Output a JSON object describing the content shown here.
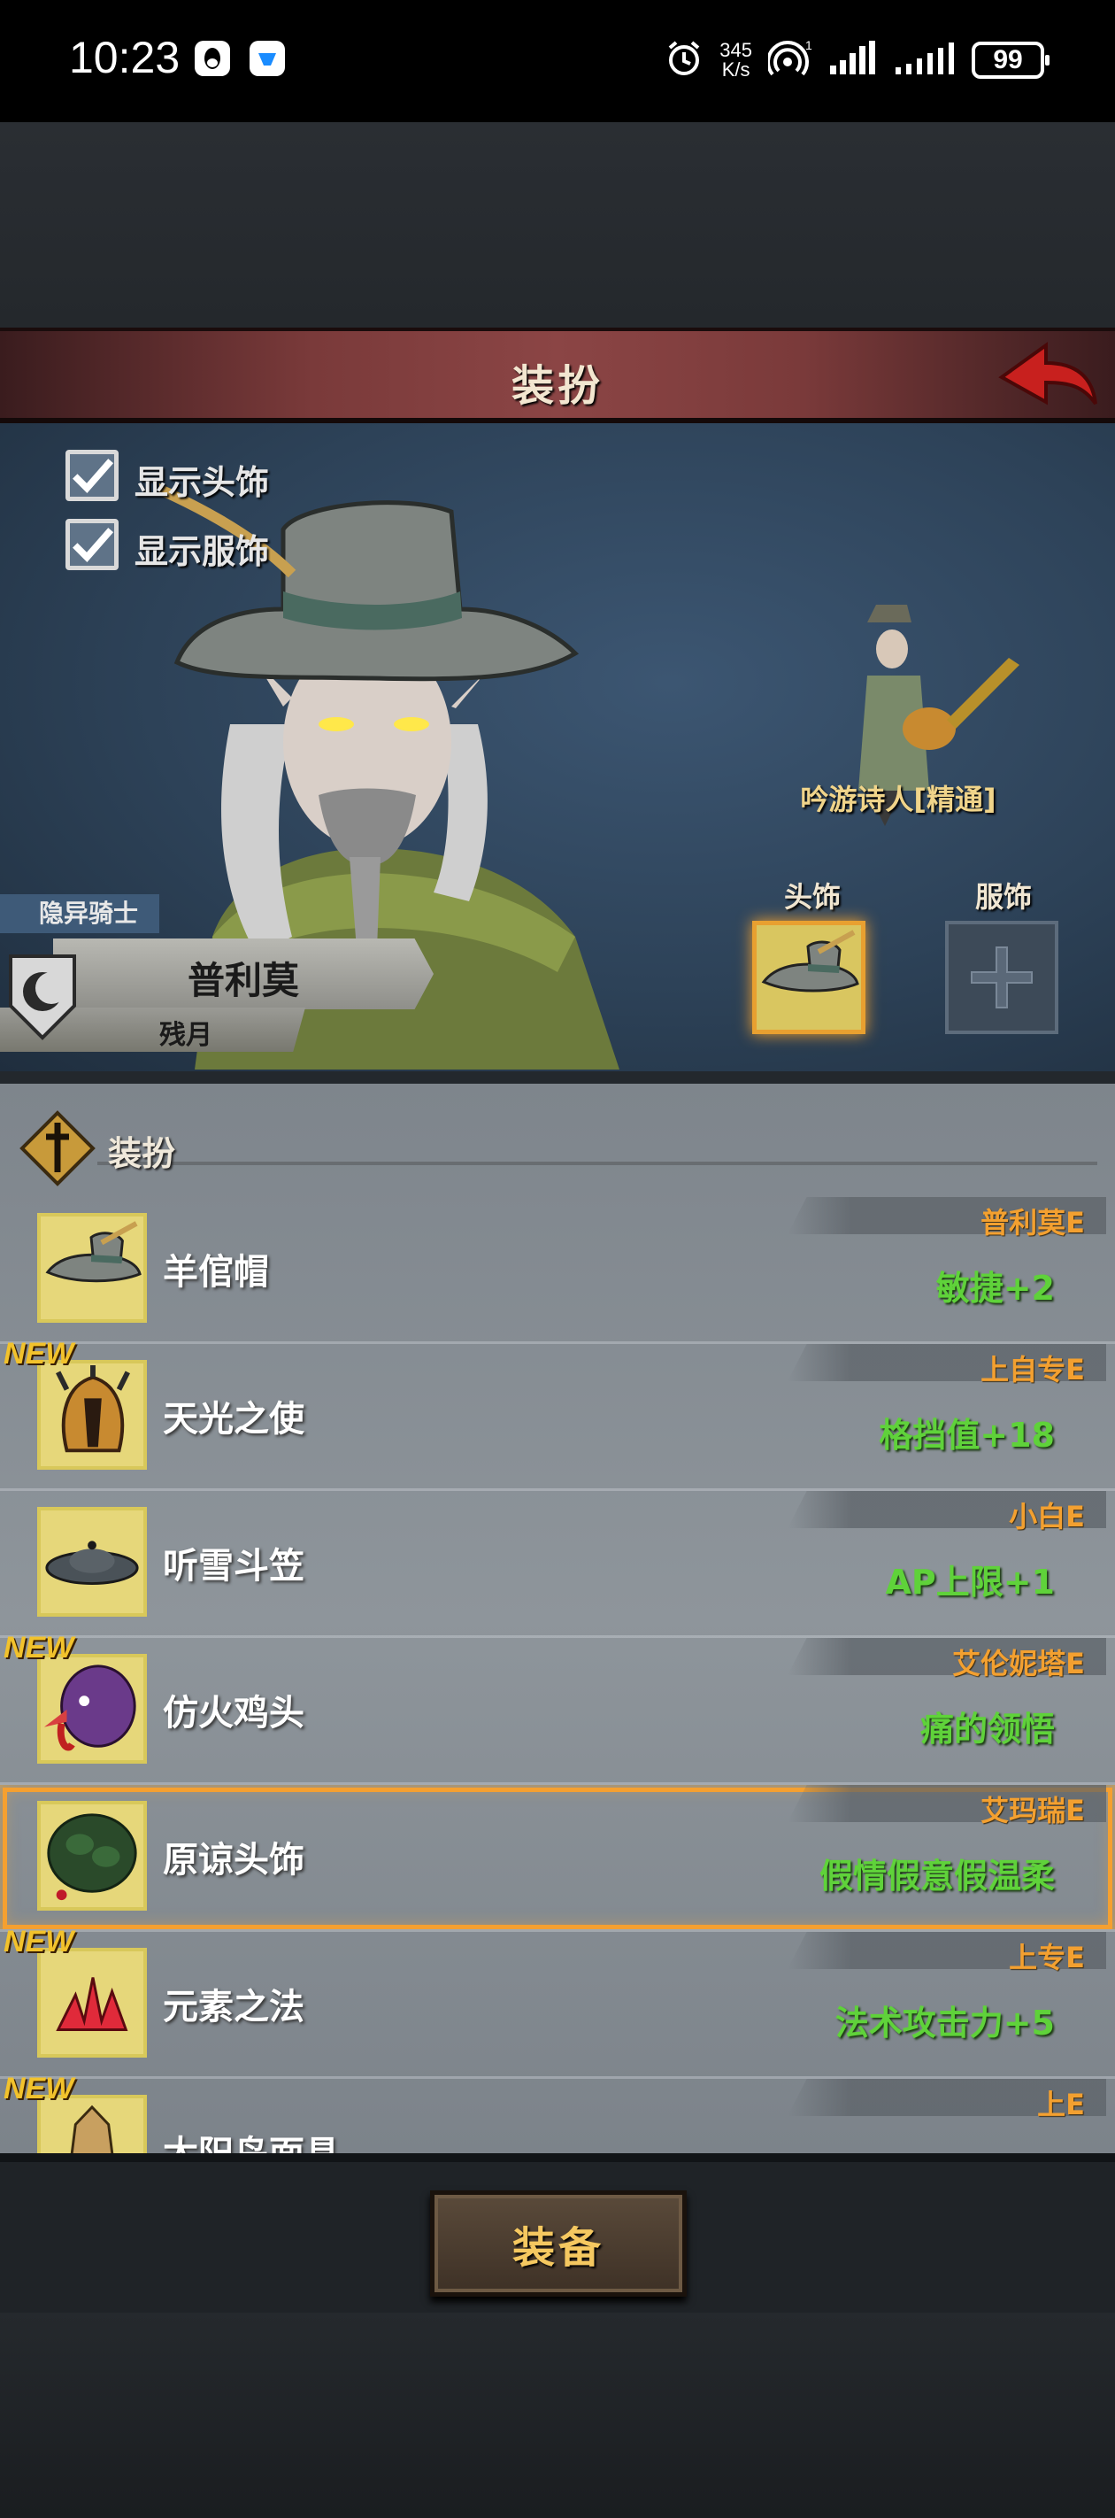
{
  "status_bar": {
    "time": "10:23",
    "net_speed_value": "345",
    "net_speed_unit": "K/s",
    "battery": "99"
  },
  "header": {
    "title": "装扮"
  },
  "options": {
    "show_headwear_label": "显示头饰",
    "show_outfit_label": "显示服饰",
    "show_headwear_checked": true,
    "show_outfit_checked": true
  },
  "character": {
    "title": "隐异骑士",
    "name": "普利莫",
    "subtitle": "残月",
    "class_name": "吟游诗人[精通]"
  },
  "slots": {
    "head_label": "头饰",
    "body_label": "服饰"
  },
  "list": {
    "section_label": "装扮",
    "items": [
      {
        "name": "羊倌帽",
        "owner": "普利莫E",
        "stat": "敏捷+2",
        "is_new": false,
        "new_label": "",
        "selected": false
      },
      {
        "name": "天光之使",
        "owner": "上自专E",
        "stat": "格挡值+18",
        "is_new": true,
        "new_label": "NEW",
        "selected": false
      },
      {
        "name": "听雪斗笠",
        "owner": "小白E",
        "stat": "AP上限+1",
        "is_new": false,
        "new_label": "",
        "selected": false
      },
      {
        "name": "仿火鸡头",
        "owner": "艾伦妮塔E",
        "stat": "痛的领悟",
        "is_new": true,
        "new_label": "NEW",
        "selected": false
      },
      {
        "name": "原谅头饰",
        "owner": "艾玛瑞E",
        "stat": "假情假意假温柔",
        "is_new": false,
        "new_label": "",
        "selected": true
      },
      {
        "name": "元素之法",
        "owner": "上专E",
        "stat": "法术攻击力+5",
        "is_new": true,
        "new_label": "NEW",
        "selected": false
      },
      {
        "name": "太阳鸟面具",
        "owner": "上E",
        "stat": "",
        "is_new": true,
        "new_label": "NEW",
        "selected": false
      }
    ]
  },
  "footer": {
    "equip_label": "装备"
  },
  "colors": {
    "banner": "#8b4545",
    "owner_text": "#f3a030",
    "stat_text": "#5fd23a",
    "selected_outline": "#f5a030",
    "equip_text": "#f5c860"
  }
}
